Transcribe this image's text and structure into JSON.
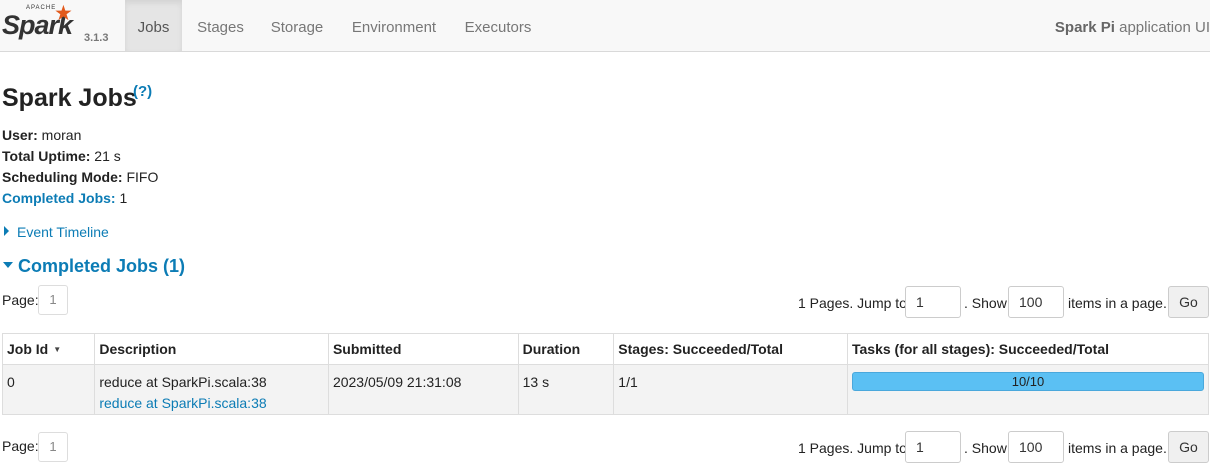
{
  "brand": {
    "apache": "APACHE",
    "name": "Spark",
    "version": "3.1.3"
  },
  "nav": {
    "tabs": [
      {
        "label": "Jobs",
        "active": true
      },
      {
        "label": "Stages"
      },
      {
        "label": "Storage"
      },
      {
        "label": "Environment"
      },
      {
        "label": "Executors"
      }
    ],
    "app_name": "Spark Pi",
    "app_suffix": " application UI"
  },
  "page": {
    "title": "Spark Jobs",
    "help": "(?)",
    "info": [
      {
        "label": "User:",
        "value": " moran"
      },
      {
        "label": "Total Uptime:",
        "value": " 21 s"
      },
      {
        "label": "Scheduling Mode:",
        "value": " FIFO"
      },
      {
        "label": "Completed Jobs:",
        "value": " 1"
      }
    ],
    "event_timeline": "Event Timeline",
    "section_title": "Completed Jobs (1)"
  },
  "pagination": {
    "page_label": "Page:",
    "current_page": "1",
    "pages_text": "1 Pages. Jump to",
    "jump_value": "1",
    "show_label": ". Show",
    "show_value": "100",
    "items_label": "items in a page.",
    "go_label": "Go"
  },
  "table": {
    "headers": [
      "Job Id",
      "Description",
      "Submitted",
      "Duration",
      "Stages: Succeeded/Total",
      "Tasks (for all stages): Succeeded/Total"
    ],
    "sort_indicator": "▼",
    "rows": [
      {
        "job_id": "0",
        "description": "reduce at SparkPi.scala:38",
        "description_link": "reduce at SparkPi.scala:38",
        "submitted": "2023/05/09 21:31:08",
        "duration": "13 s",
        "stages": "1/1",
        "tasks": "10/10",
        "tasks_progress": 1.0
      }
    ]
  },
  "colors": {
    "accent": "#0c7cb5",
    "progress": "#5bc0f3",
    "spark_orange": "#e25a1c"
  }
}
